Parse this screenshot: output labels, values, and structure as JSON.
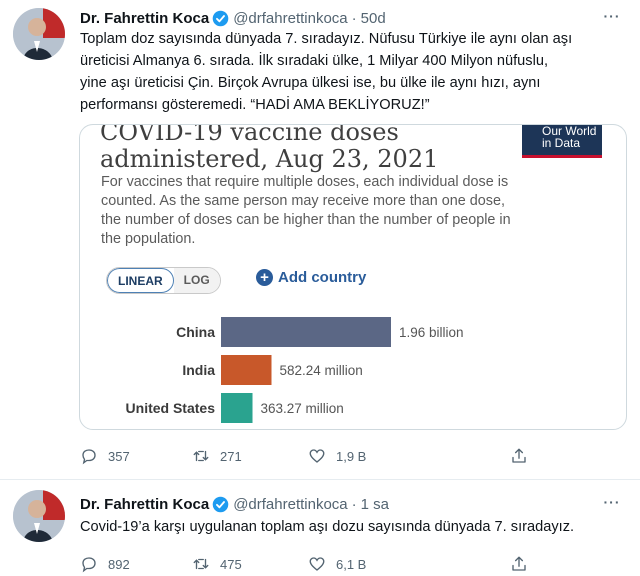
{
  "tweets": [
    {
      "author_name": "Dr. Fahrettin Koca",
      "handle": "@drfahrettinkoca",
      "time": "50d",
      "more": "···",
      "text": "Toplam doz sayısında dünyada 7. sıradayız. Nüfusu Türkiye ile aynı olan aşı\nüreticisi Almanya 6. sırada. İlk sıradaki ülke, 1 Milyar 400 Milyon nüfuslu,\nyine aşı üreticisi Çin. Birçok Avrupa ülkesi ise, bu ülke ile aynı hızı, aynı\nperformansı gösteremedi. “HADİ AMA BEKLİYORUZ!”",
      "replies": "357",
      "retweets": "271",
      "likes": "1,9 B",
      "card": {
        "title": "COVID-19 vaccine doses\nadministered, Aug 23, 2021",
        "logo_text": "Our World\nin Data",
        "description": "For vaccines that require multiple doses, each individual dose is\ncounted. As the same person may receive more than one dose,\nthe number of doses can be higher than the number of people in\nthe population.",
        "toggle_linear": "LINEAR",
        "toggle_log": "LOG",
        "add_country": "Add country"
      }
    },
    {
      "author_name": "Dr. Fahrettin Koca",
      "handle": "@drfahrettinkoca",
      "time": "1 sa",
      "more": "···",
      "text": "Covid-19’a karşı uygulanan toplam aşı dozu sayısında dünyada 7. sıradayız.",
      "replies": "892",
      "retweets": "475",
      "likes": "6,1 B"
    }
  ],
  "chart_data": {
    "type": "bar",
    "orientation": "horizontal",
    "title": "COVID-19 vaccine doses administered, Aug 23, 2021",
    "categories": [
      "China",
      "India",
      "United States"
    ],
    "values": [
      1960000000,
      582240000,
      363270000
    ],
    "value_labels": [
      "1.96 billion",
      "582.24 million",
      "363.27 million"
    ],
    "colors": [
      "#5b6785",
      "#c8582a",
      "#2aa38f"
    ],
    "scale": "linear"
  }
}
